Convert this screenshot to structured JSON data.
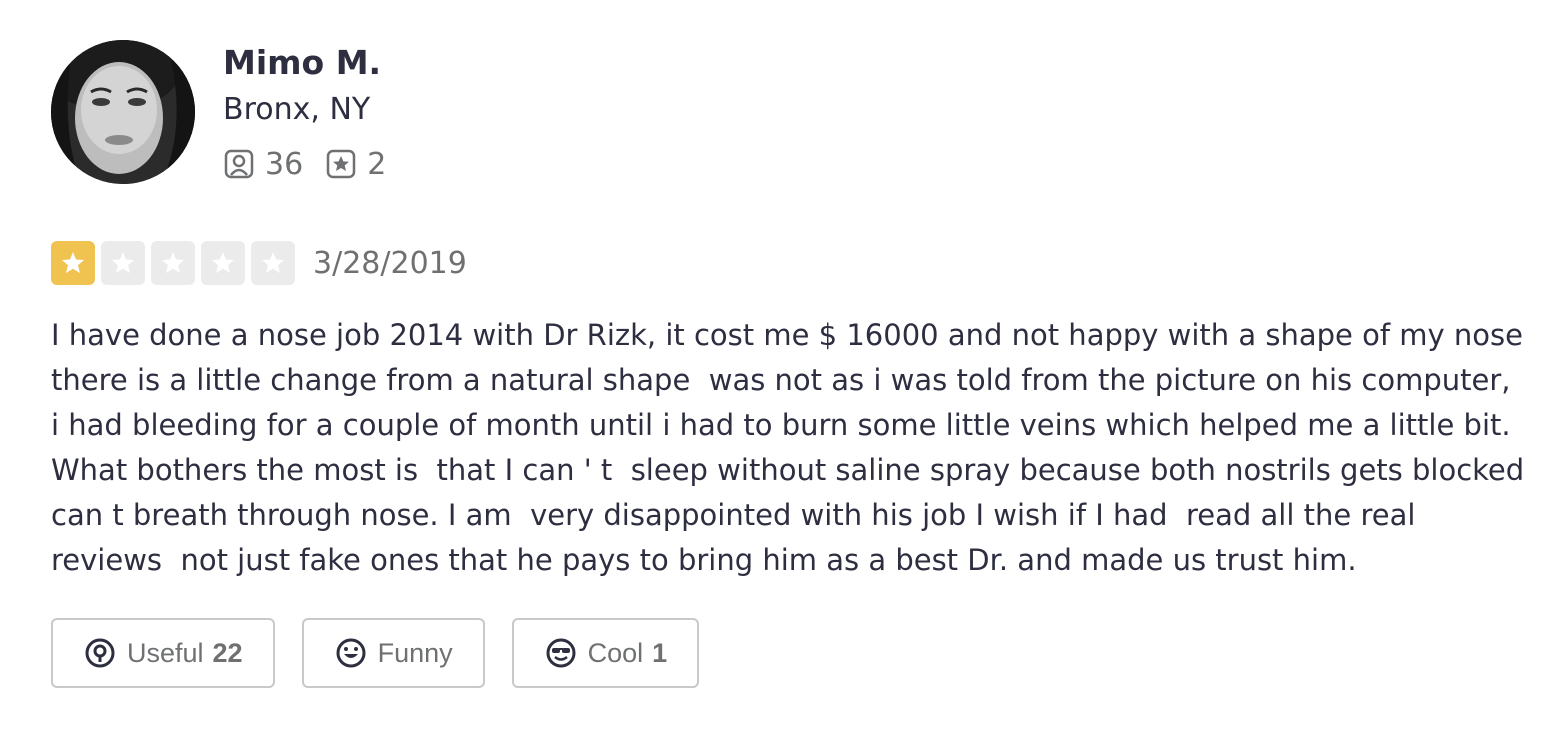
{
  "user": {
    "name": "Mimo M.",
    "location": "Bronx, NY",
    "friends_count": "36",
    "reviews_count": "2"
  },
  "review": {
    "rating": 1,
    "max_rating": 5,
    "date": "3/28/2019",
    "text_lines": [
      "I have done a nose job 2014 with Dr Rizk, it cost me $ 16000 and not happy with a shape of my nose",
      "there is a little change from a natural shape  was not as i was told from the picture on his computer,",
      "i had bleeding for a couple of month until i had to burn some little veins which helped me a little bit.",
      "What bothers the most is  that I can ' t  sleep without saline spray because both nostrils gets blocked",
      "can t breath through nose. I am  very disappointed with his job I wish if I had  read all the real",
      "reviews  not just fake ones that he pays to bring him as a best Dr. and made us trust him."
    ]
  },
  "reactions": {
    "useful": {
      "label": "Useful",
      "count": "22"
    },
    "funny": {
      "label": "Funny",
      "count": ""
    },
    "cool": {
      "label": "Cool",
      "count": "1"
    }
  },
  "colors": {
    "star_filled": "#f0c24f",
    "star_empty": "#ebebeb",
    "text_primary": "#2d2e40",
    "text_secondary": "#6e7072",
    "button_border": "#c8c9ca"
  },
  "icons": {
    "friends": "friends-icon",
    "reviews": "review-star-icon",
    "useful": "lightbulb-icon",
    "funny": "smiley-icon",
    "cool": "sunglasses-icon"
  }
}
